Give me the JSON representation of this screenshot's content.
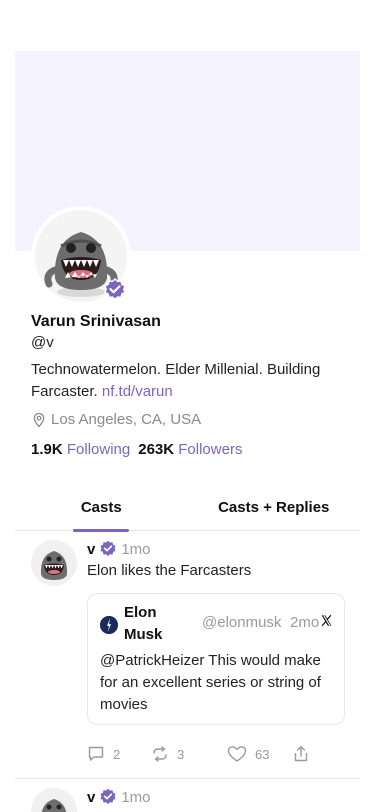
{
  "profile": {
    "name": "Varun Srinivasan",
    "handle": "@v",
    "bio_text": "Technowatermelon. Elder Millenial. Building Farcaster. ",
    "bio_link": "nf.td/varun",
    "location": "Los Angeles, CA, USA",
    "following_count": "1.9K",
    "following_label": "Following",
    "followers_count": "263K",
    "followers_label": "Followers"
  },
  "tabs": [
    {
      "label": "Casts",
      "active": true
    },
    {
      "label": "Casts + Replies",
      "active": false
    }
  ],
  "casts": [
    {
      "user": "v",
      "time": "1mo",
      "text": "Elon likes the Farcasters",
      "quote": {
        "name": "Elon Musk",
        "handle": "@elonmusk",
        "time": "2mo",
        "source_icon": "x-logo",
        "text": "@PatrickHeizer This would make for an excellent series or string of movies"
      },
      "replies": "2",
      "recasts": "3",
      "likes": "63"
    },
    {
      "user": "v",
      "time": "1mo"
    }
  ],
  "colors": {
    "accent": "#7c65c1",
    "banner": "#f5f3ff",
    "muted": "#9a9a9a"
  }
}
